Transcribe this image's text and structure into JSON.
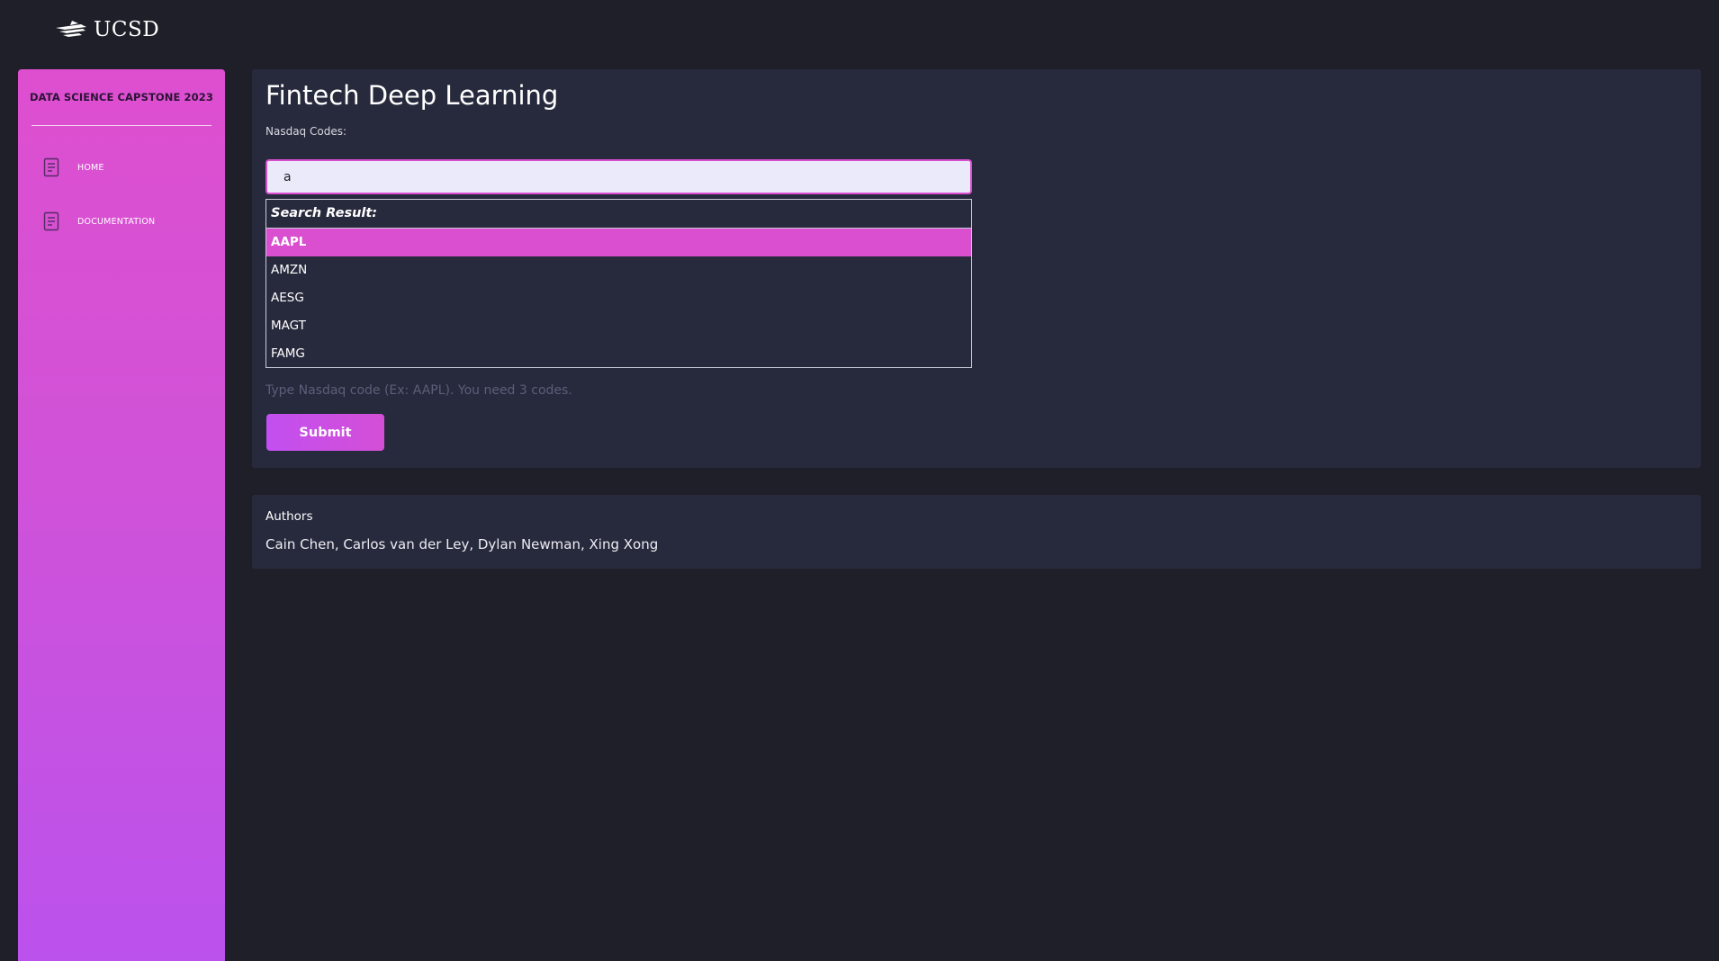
{
  "header": {
    "logo_text": "UCSD"
  },
  "sidebar": {
    "title": "DATA SCIENCE CAPSTONE 2023",
    "items": [
      {
        "label": "HOME",
        "icon": "document-icon"
      },
      {
        "label": "DOCUMENTATION",
        "icon": "document-icon"
      }
    ]
  },
  "main": {
    "title": "Fintech Deep Learning",
    "field_label": "Nasdaq Codes:",
    "search": {
      "value": "a"
    },
    "results": {
      "header": "Search Result:",
      "items": [
        "AAPL",
        "AMZN",
        "AESG",
        "MAGT",
        "FAMG"
      ],
      "highlighted": "AAPL"
    },
    "hint": "Type Nasdaq code (Ex: AAPL). You need 3 codes.",
    "submit_label": "Submit"
  },
  "authors": {
    "title": "Authors",
    "names": "Cain Chen, Carlos van der Ley, Dylan Newman, Xing Xong"
  },
  "colors": {
    "background": "#1f1f29",
    "panel": "#272a3d",
    "accent": "#d94fd0",
    "sidebar_gradient_top": "#de4fcf",
    "sidebar_gradient_bottom": "#bb52ec"
  }
}
